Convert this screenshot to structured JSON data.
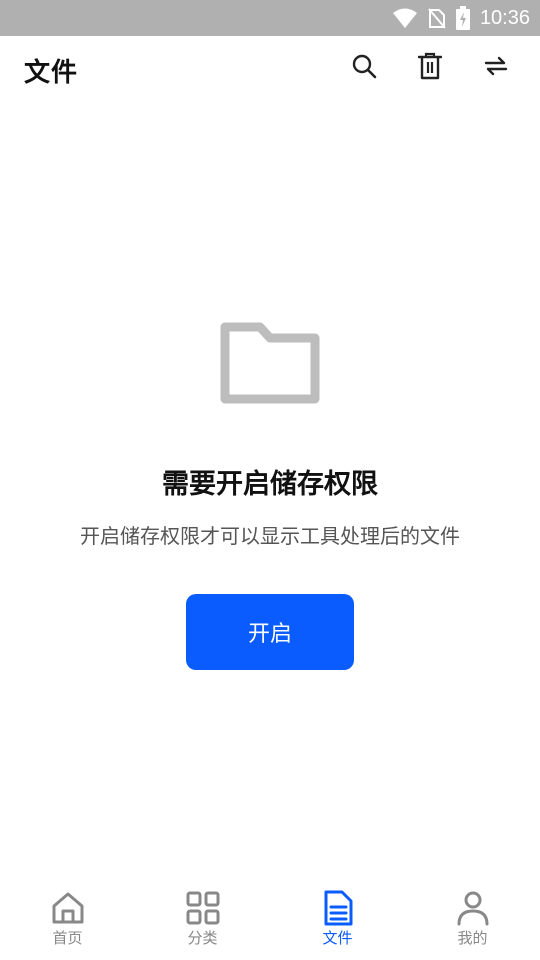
{
  "status_bar": {
    "time": "10:36"
  },
  "header": {
    "title": "文件"
  },
  "empty_state": {
    "title": "需要开启储存权限",
    "description": "开启储存权限才可以显示工具处理后的文件",
    "button_label": "开启"
  },
  "bottom_nav": {
    "items": [
      {
        "label": "首页",
        "icon": "home-icon"
      },
      {
        "label": "分类",
        "icon": "grid-icon"
      },
      {
        "label": "文件",
        "icon": "document-icon",
        "active": true
      },
      {
        "label": "我的",
        "icon": "user-icon"
      }
    ]
  },
  "colors": {
    "accent": "#0a5cff",
    "status_bar": "#b0b0b0",
    "icon_gray": "#bdbdbd",
    "nav_gray": "#888888"
  }
}
